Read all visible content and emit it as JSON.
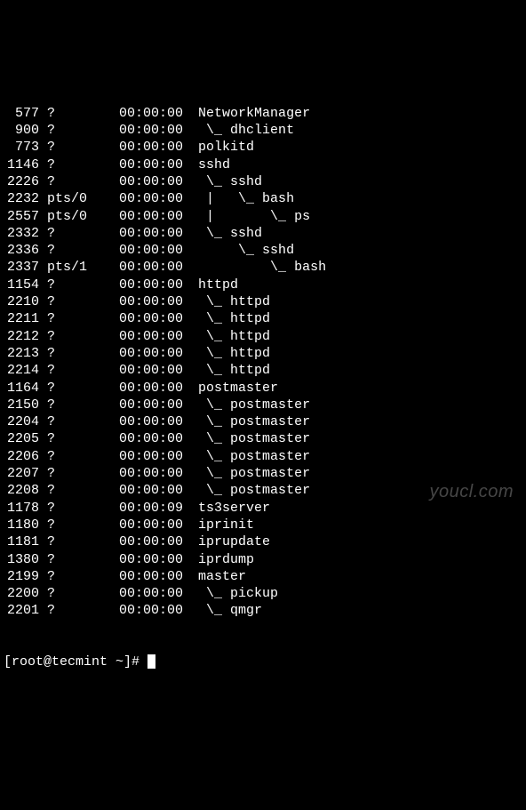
{
  "processes": [
    {
      "pid": "577",
      "tty": "?",
      "time": "00:00:00",
      "cmd": "NetworkManager"
    },
    {
      "pid": "900",
      "tty": "?",
      "time": "00:00:00",
      "cmd": " \\_ dhclient"
    },
    {
      "pid": "773",
      "tty": "?",
      "time": "00:00:00",
      "cmd": "polkitd"
    },
    {
      "pid": "1146",
      "tty": "?",
      "time": "00:00:00",
      "cmd": "sshd"
    },
    {
      "pid": "2226",
      "tty": "?",
      "time": "00:00:00",
      "cmd": " \\_ sshd"
    },
    {
      "pid": "2232",
      "tty": "pts/0",
      "time": "00:00:00",
      "cmd": " |   \\_ bash"
    },
    {
      "pid": "2557",
      "tty": "pts/0",
      "time": "00:00:00",
      "cmd": " |       \\_ ps"
    },
    {
      "pid": "2332",
      "tty": "?",
      "time": "00:00:00",
      "cmd": " \\_ sshd"
    },
    {
      "pid": "2336",
      "tty": "?",
      "time": "00:00:00",
      "cmd": "     \\_ sshd"
    },
    {
      "pid": "2337",
      "tty": "pts/1",
      "time": "00:00:00",
      "cmd": "         \\_ bash"
    },
    {
      "pid": "1154",
      "tty": "?",
      "time": "00:00:00",
      "cmd": "httpd"
    },
    {
      "pid": "2210",
      "tty": "?",
      "time": "00:00:00",
      "cmd": " \\_ httpd"
    },
    {
      "pid": "2211",
      "tty": "?",
      "time": "00:00:00",
      "cmd": " \\_ httpd"
    },
    {
      "pid": "2212",
      "tty": "?",
      "time": "00:00:00",
      "cmd": " \\_ httpd"
    },
    {
      "pid": "2213",
      "tty": "?",
      "time": "00:00:00",
      "cmd": " \\_ httpd"
    },
    {
      "pid": "2214",
      "tty": "?",
      "time": "00:00:00",
      "cmd": " \\_ httpd"
    },
    {
      "pid": "1164",
      "tty": "?",
      "time": "00:00:00",
      "cmd": "postmaster"
    },
    {
      "pid": "2150",
      "tty": "?",
      "time": "00:00:00",
      "cmd": " \\_ postmaster"
    },
    {
      "pid": "2204",
      "tty": "?",
      "time": "00:00:00",
      "cmd": " \\_ postmaster"
    },
    {
      "pid": "2205",
      "tty": "?",
      "time": "00:00:00",
      "cmd": " \\_ postmaster"
    },
    {
      "pid": "2206",
      "tty": "?",
      "time": "00:00:00",
      "cmd": " \\_ postmaster"
    },
    {
      "pid": "2207",
      "tty": "?",
      "time": "00:00:00",
      "cmd": " \\_ postmaster"
    },
    {
      "pid": "2208",
      "tty": "?",
      "time": "00:00:00",
      "cmd": " \\_ postmaster"
    },
    {
      "pid": "1178",
      "tty": "?",
      "time": "00:00:09",
      "cmd": "ts3server"
    },
    {
      "pid": "1180",
      "tty": "?",
      "time": "00:00:00",
      "cmd": "iprinit"
    },
    {
      "pid": "1181",
      "tty": "?",
      "time": "00:00:00",
      "cmd": "iprupdate"
    },
    {
      "pid": "1380",
      "tty": "?",
      "time": "00:00:00",
      "cmd": "iprdump"
    },
    {
      "pid": "2199",
      "tty": "?",
      "time": "00:00:00",
      "cmd": "master"
    },
    {
      "pid": "2200",
      "tty": "?",
      "time": "00:00:00",
      "cmd": " \\_ pickup"
    },
    {
      "pid": "2201",
      "tty": "?",
      "time": "00:00:00",
      "cmd": " \\_ qmgr"
    }
  ],
  "prompt": "[root@tecmint ~]# ",
  "watermark": "youcl.com"
}
